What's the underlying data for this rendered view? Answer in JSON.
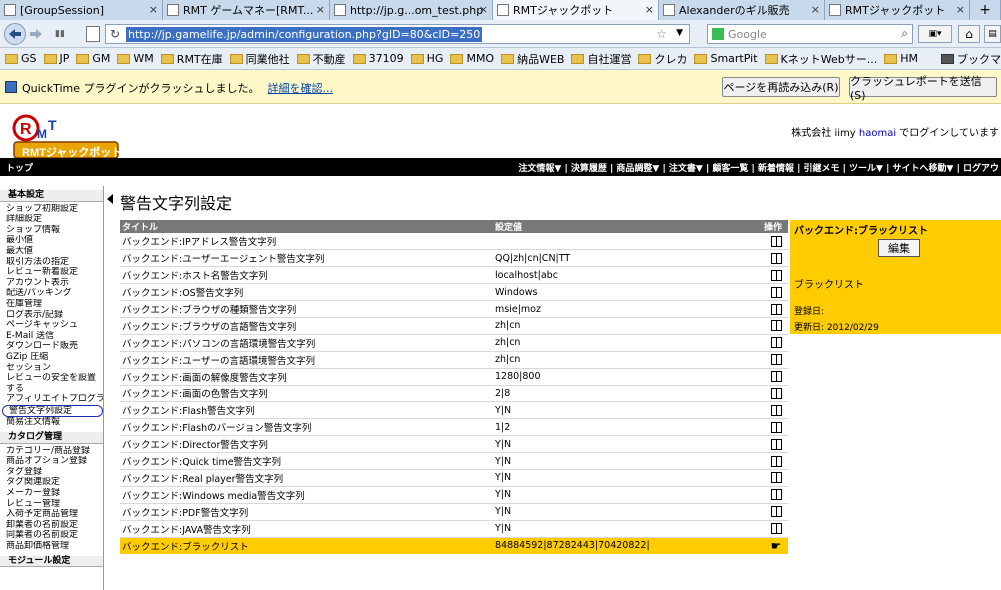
{
  "browser": {
    "tabs": [
      {
        "label": "[GroupSession]",
        "active": false
      },
      {
        "label": "RMT ゲームマネー[RMT...",
        "active": false
      },
      {
        "label": "http://jp.g...om_test.php",
        "active": false
      },
      {
        "label": "RMTジャックポット",
        "active": true
      },
      {
        "label": "Alexanderのギル販売",
        "active": false
      },
      {
        "label": "RMTジャックポット",
        "active": false
      }
    ],
    "url": "http://jp.gamelife.jp/admin/configuration.php?gID=80&cID=250",
    "search_placeholder": "Google",
    "bookmarks": [
      "GS",
      "JP",
      "GM",
      "WM",
      "RMT在庫",
      "同業他社",
      "不動産",
      "37109",
      "HG",
      "MMO",
      "納品WEB",
      "自社運営",
      "クレカ",
      "SmartPit",
      "KネットWebサー...",
      "HM"
    ],
    "bookmarks_menu": "ブックマ",
    "infobar": {
      "message": "QuickTime プラグインがクラッシュしました。",
      "details_link": "詳細を確認...",
      "reload_button": "ページを再読み込み(R)",
      "report_button": "クラッシュレポートを送信(S)"
    }
  },
  "site": {
    "logo_text": "RMTジャックポット",
    "login_prefix": "株式会社 iimy",
    "login_user": "haomai",
    "login_suffix": "でログインしています",
    "nav_home": "トップ",
    "nav_menu": "注文情報▼ | 決算履歴 | 商品調整▼ | 注文書▼ | 顧客一覧 | 新着情報 | 引継メモ | ツール▼ | サイトへ移動▼ | ログアウ"
  },
  "sidebar": {
    "sections": [
      {
        "header": "基本設定",
        "items": [
          "ショップ初期設定",
          "詳細設定",
          "ショップ情報",
          "最小値",
          "最大値",
          "取引方法の指定",
          "レビュー新着設定",
          "アカウント表示",
          "配送/パッキング",
          "在庫管理",
          "ログ表示/記録",
          "ページキャッシュ",
          "E-Mail 送信",
          "ダウンロード販売",
          "GZip 圧縮",
          "セッション",
          "レビューの安全を設置",
          "する",
          "アフィリエイトプログラム",
          "警告文字列設定",
          "簡易注文情報"
        ],
        "selected": "警告文字列設定"
      },
      {
        "header": "カタログ管理",
        "items": [
          "カテゴリー/商品登録",
          "商品オプション登録",
          "タグ登録",
          "タグ関連設定",
          "メーカー登録",
          "レビュー管理",
          "入荷予定商品管理",
          "卸業者の名前設定",
          "同業者の名前設定",
          "商品卸価格管理"
        ]
      },
      {
        "header": "モジュール設定",
        "items": []
      }
    ]
  },
  "main": {
    "title": "警告文字列設定",
    "columns": {
      "title": "タイトル",
      "value": "設定値",
      "op": "操作"
    },
    "rows": [
      {
        "title": "バックエンド:IPアドレス警告文字列",
        "value": ""
      },
      {
        "title": "バックエンド:ユーザーエージェント警告文字列",
        "value": "QQ|zh|cn|CN|TT"
      },
      {
        "title": "バックエンド:ホスト名警告文字列",
        "value": "localhost|abc"
      },
      {
        "title": "バックエンド:OS警告文字列",
        "value": "Windows"
      },
      {
        "title": "バックエンド:ブラウザの種類警告文字列",
        "value": "msie|moz"
      },
      {
        "title": "バックエンド:ブラウザの言語警告文字列",
        "value": "zh|cn"
      },
      {
        "title": "バックエンド:パソコンの言語環境警告文字列",
        "value": "zh|cn"
      },
      {
        "title": "バックエンド:ユーザーの言語環境警告文字列",
        "value": "zh|cn"
      },
      {
        "title": "バックエンド:画面の解像度警告文字列",
        "value": "1280|800"
      },
      {
        "title": "バックエンド:画面の色警告文字列",
        "value": "2|8"
      },
      {
        "title": "バックエンド:Flash警告文字列",
        "value": "Y|N"
      },
      {
        "title": "バックエンド:Flashのバージョン警告文字列",
        "value": "1|2"
      },
      {
        "title": "バックエンド:Director警告文字列",
        "value": "Y|N"
      },
      {
        "title": "バックエンド:Quick time警告文字列",
        "value": "Y|N"
      },
      {
        "title": "バックエンド:Real player警告文字列",
        "value": "Y|N"
      },
      {
        "title": "バックエンド:Windows media警告文字列",
        "value": "Y|N"
      },
      {
        "title": "バックエンド:PDF警告文字列",
        "value": "Y|N"
      },
      {
        "title": "バックエンド:JAVA警告文字列",
        "value": "Y|N"
      },
      {
        "title": "バックエンド:ブラックリスト",
        "value": "84884592|87282443|70420822|",
        "highlighted": true
      }
    ]
  },
  "detail": {
    "header": "バックエンド:ブラックリスト",
    "edit_button": "編集",
    "name": "ブラックリスト",
    "registered_label": "登録日:",
    "updated_label": "更新日:",
    "updated_value": "2012/02/29"
  },
  "colors": {
    "highlight": "#ffcc00",
    "nav_bg": "#000000",
    "table_header": "#787878",
    "selection": "#3b6fc4"
  }
}
